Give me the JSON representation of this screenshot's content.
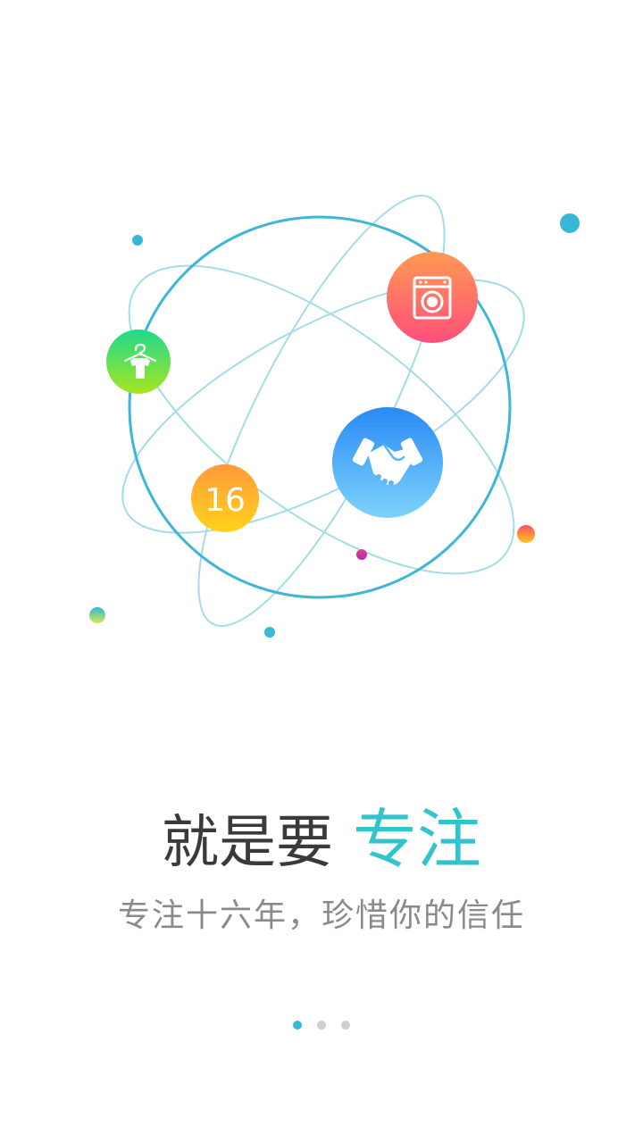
{
  "onboarding": {
    "headline_lead": "就是要",
    "headline_accent": "专注",
    "subtitle": "专注十六年，珍惜你的信任",
    "badge_number": "16"
  },
  "colors": {
    "accent": "#33c3cc",
    "orbit": "#3fb5d8",
    "orbit_light": "#9fd9e6",
    "dot_active": "#36b8d6",
    "dot_inactive": "#cfcfcf"
  },
  "icons": {
    "washer": "washing-machine-icon",
    "hanger": "shirt-hanger-icon",
    "handshake": "handshake-icon"
  },
  "pager": {
    "count": 3,
    "active_index": 0
  }
}
